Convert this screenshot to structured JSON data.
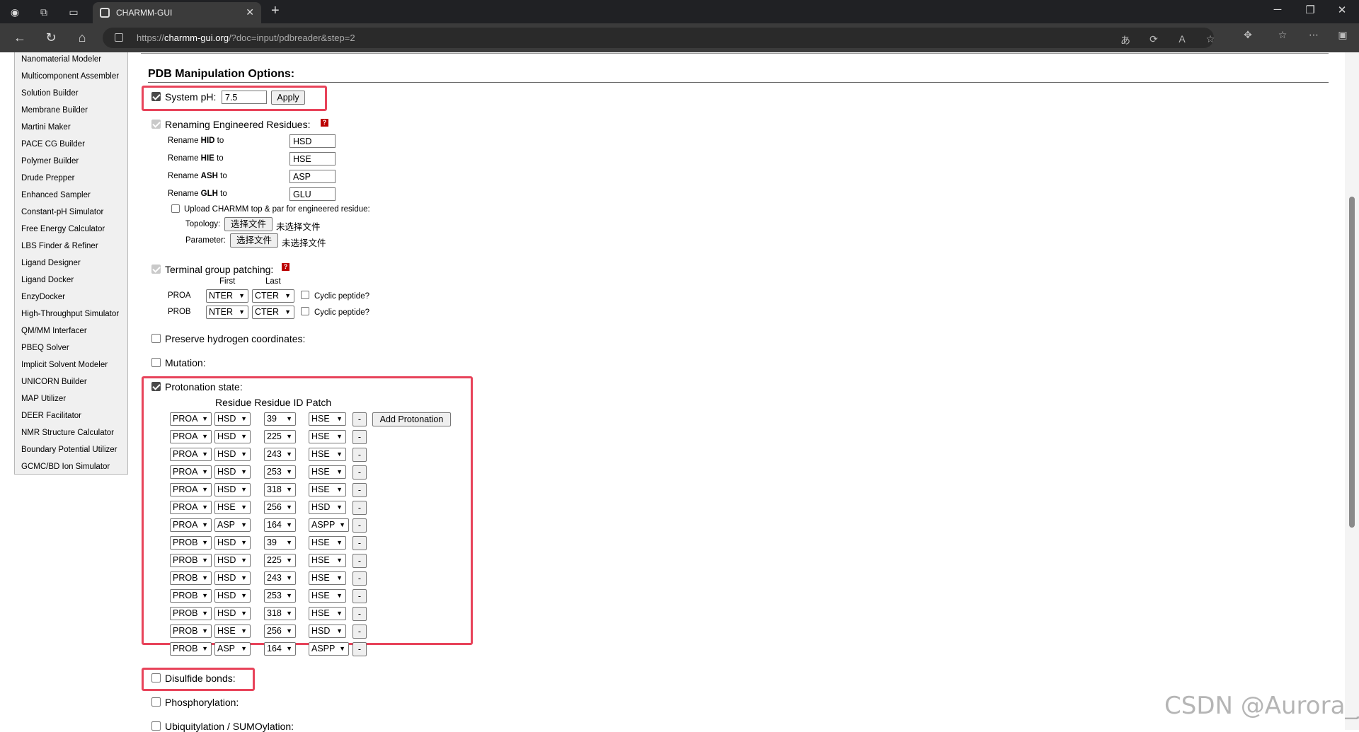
{
  "browser": {
    "tab_title": "CHARMM-GUI",
    "url_prefix": "https://",
    "url_host": "charmm-gui.org",
    "url_path": "/?doc=input/pdbreader&step=2"
  },
  "sidebar": {
    "items": [
      "Nanomaterial Modeler",
      "Multicomponent Assembler",
      "Solution Builder",
      "Membrane Builder",
      "Martini Maker",
      "PACE CG Builder",
      "Polymer Builder",
      "Drude Prepper",
      "Enhanced Sampler",
      "Constant-pH Simulator",
      "Free Energy Calculator",
      "LBS Finder & Refiner",
      "Ligand Designer",
      "Ligand Docker",
      "EnzyDocker",
      "High-Throughput Simulator",
      "QM/MM Interfacer",
      "PBEQ Solver",
      "Implicit Solvent Modeler",
      "UNICORN Builder",
      "MAP Utilizer",
      "DEER Facilitator",
      "NMR Structure Calculator",
      "Boundary Potential Utilizer",
      "GCMC/BD Ion Simulator"
    ]
  },
  "main": {
    "heading": "PDB Manipulation Options:",
    "system_ph": {
      "label": "System pH:",
      "value": "7.5",
      "apply": "Apply",
      "checked": true
    },
    "renaming": {
      "label": "Renaming Engineered Residues:",
      "help": "?",
      "rows": [
        {
          "prefix": "Rename ",
          "bold": "HID",
          "suffix": " to",
          "value": "HSD"
        },
        {
          "prefix": "Rename ",
          "bold": "HIE",
          "suffix": " to",
          "value": "HSE"
        },
        {
          "prefix": "Rename ",
          "bold": "ASH",
          "suffix": " to",
          "value": "ASP"
        },
        {
          "prefix": "Rename ",
          "bold": "GLH",
          "suffix": " to",
          "value": "GLU"
        }
      ],
      "upload_label": "Upload CHARMM top & par for engineered residue:",
      "topology_label": "Topology:",
      "parameter_label": "Parameter:",
      "choose_file": "选择文件",
      "no_file": "未选择文件"
    },
    "terminal": {
      "label": "Terminal group patching:",
      "help": "?",
      "first_header": "First",
      "last_header": "Last",
      "rows": [
        {
          "chain": "PROA",
          "first": "NTER",
          "last": "CTER",
          "cyclic": "Cyclic peptide?"
        },
        {
          "chain": "PROB",
          "first": "NTER",
          "last": "CTER",
          "cyclic": "Cyclic peptide?"
        }
      ]
    },
    "preserve_h": "Preserve hydrogen coordinates:",
    "mutation": "Mutation:",
    "protonation": {
      "label": "Protonation state:",
      "header": "Residue Residue ID Patch",
      "add_button": "Add Protonation",
      "remove_label": "-",
      "rows": [
        {
          "chain": "PROA",
          "residue": "HSD",
          "resid": "39",
          "patch": "HSE"
        },
        {
          "chain": "PROA",
          "residue": "HSD",
          "resid": "225",
          "patch": "HSE"
        },
        {
          "chain": "PROA",
          "residue": "HSD",
          "resid": "243",
          "patch": "HSE"
        },
        {
          "chain": "PROA",
          "residue": "HSD",
          "resid": "253",
          "patch": "HSE"
        },
        {
          "chain": "PROA",
          "residue": "HSD",
          "resid": "318",
          "patch": "HSE"
        },
        {
          "chain": "PROA",
          "residue": "HSE",
          "resid": "256",
          "patch": "HSD"
        },
        {
          "chain": "PROA",
          "residue": "ASP",
          "resid": "164",
          "patch": "ASPP"
        },
        {
          "chain": "PROB",
          "residue": "HSD",
          "resid": "39",
          "patch": "HSE"
        },
        {
          "chain": "PROB",
          "residue": "HSD",
          "resid": "225",
          "patch": "HSE"
        },
        {
          "chain": "PROB",
          "residue": "HSD",
          "resid": "243",
          "patch": "HSE"
        },
        {
          "chain": "PROB",
          "residue": "HSD",
          "resid": "253",
          "patch": "HSE"
        },
        {
          "chain": "PROB",
          "residue": "HSD",
          "resid": "318",
          "patch": "HSE"
        },
        {
          "chain": "PROB",
          "residue": "HSE",
          "resid": "256",
          "patch": "HSD"
        },
        {
          "chain": "PROB",
          "residue": "ASP",
          "resid": "164",
          "patch": "ASPP"
        }
      ]
    },
    "disulfide": "Disulfide bonds:",
    "phosphorylation": "Phosphorylation:",
    "ubiquitylation": "Ubiquitylation / SUMOylation:"
  },
  "watermark": "CSDN @Aurora_j",
  "colors": {
    "highlight": "#e8435a",
    "help_icon": "#b00000"
  }
}
